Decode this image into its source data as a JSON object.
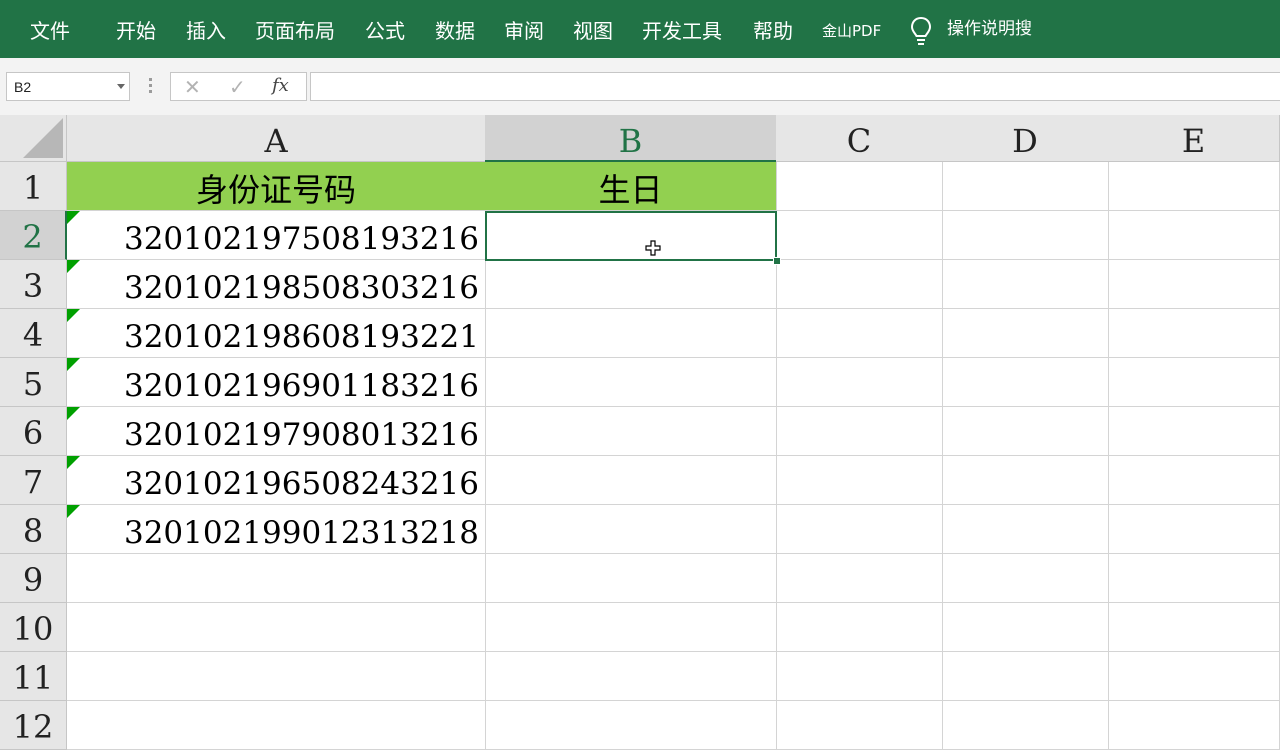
{
  "ribbon": {
    "tabs": [
      "文件",
      "开始",
      "插入",
      "页面布局",
      "公式",
      "数据",
      "审阅",
      "视图",
      "开发工具",
      "帮助",
      "金山PDF"
    ],
    "tell_me": "操作说明搜"
  },
  "formula_bar": {
    "name_box": "B2",
    "cancel_icon": "✕",
    "enter_icon": "✓",
    "fx_label": "fx",
    "formula_value": ""
  },
  "columns": [
    "A",
    "B",
    "C",
    "D",
    "E"
  ],
  "selected_column": "B",
  "rows": [
    "1",
    "2",
    "3",
    "4",
    "5",
    "6",
    "7",
    "8",
    "9",
    "10",
    "11",
    "12"
  ],
  "selected_row": "2",
  "sheet": {
    "header": {
      "a": "身份证号码",
      "b": "生日"
    },
    "ids": [
      "320102197508193216",
      "320102198508303216",
      "320102198608193221",
      "320102196901183216",
      "320102197908013216",
      "320102196508243216",
      "320102199012313218"
    ]
  },
  "colors": {
    "ribbon": "#217346",
    "header_fill": "#92d050",
    "selection": "#217346"
  }
}
